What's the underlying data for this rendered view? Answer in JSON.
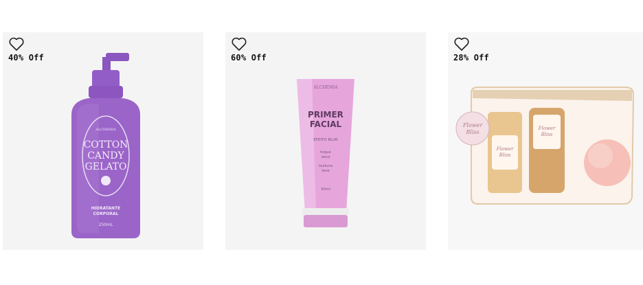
{
  "products": [
    {
      "discount": "40% Off",
      "icon": "heart-outline-icon",
      "image": {
        "brand": "ALCHEMIA",
        "name_lines": [
          "COTTON",
          "CANDY",
          "GELATO"
        ],
        "type_lines": [
          "HIDRATANTE",
          "CORPORAL"
        ],
        "size": "250mL",
        "color": "#9b64c8"
      }
    },
    {
      "discount": "60% Off",
      "icon": "heart-outline-icon",
      "image": {
        "brand": "ALCHEMIA",
        "name_lines": [
          "PRIMER",
          "FACIAL"
        ],
        "effect": "EFEITO BLUR",
        "features": [
          "toque",
          "seco",
          "textura",
          "leve"
        ],
        "size": "30ml",
        "color": "#e4a3d9"
      }
    },
    {
      "discount": "28% Off",
      "icon": "heart-outline-icon",
      "image": {
        "label": [
          "Flower",
          "Bliss"
        ],
        "color": "#f6c0b8"
      }
    }
  ]
}
